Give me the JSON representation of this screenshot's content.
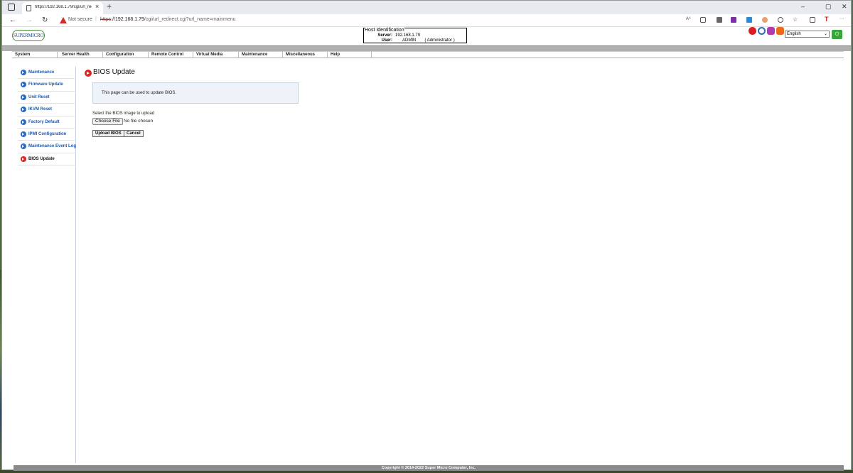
{
  "browser": {
    "tab_title": "https://192.168.1.79/cgi/url_redi",
    "tab_close": "×",
    "new_tab": "+",
    "win_min": "–",
    "win_max": "▢",
    "win_close": "✕",
    "security_label": "Not secure",
    "url_scheme": "https",
    "url_host": "://192.168.1.79",
    "url_path": "/cgi/url_redirect.cgi?url_name=mainmenu",
    "more_label": "···"
  },
  "header": {
    "logo_text": "SUPERMICRO",
    "host_title": "Host Identification",
    "server_key": "Server:",
    "server_value": "192.168.1.79",
    "user_key": "User:",
    "user_value": "ADMIN",
    "user_role": "( Administrator )",
    "language": "English"
  },
  "menu": [
    "System",
    "Server Health",
    "Configuration",
    "Remote Control",
    "Virtual Media",
    "Maintenance",
    "Miscellaneous",
    "Help"
  ],
  "sidebar": {
    "items": [
      {
        "label": "Maintenance"
      },
      {
        "label": "Firmware Update"
      },
      {
        "label": "Unit Reset"
      },
      {
        "label": "IKVM Reset"
      },
      {
        "label": "Factory Default"
      },
      {
        "label": "IPMI Configuration"
      },
      {
        "label": "Maintenance Event Log"
      },
      {
        "label": "BIOS Update"
      }
    ]
  },
  "main": {
    "title": "BIOS Update",
    "info": "This page can be used to update BIOS.",
    "select_label": "Select the BIOS image to upload",
    "choose_file": "Choose File",
    "file_status": "No file chosen",
    "upload_button": "Upload BIOS",
    "cancel_button": "Cancel"
  },
  "footer": {
    "copyright": "Copyright © 2014-2022 Super Micro Computer, Inc."
  },
  "colors": {
    "accent_red": "#dd2222",
    "link_blue": "#1e5aa8",
    "power_green": "#3aa43a"
  }
}
